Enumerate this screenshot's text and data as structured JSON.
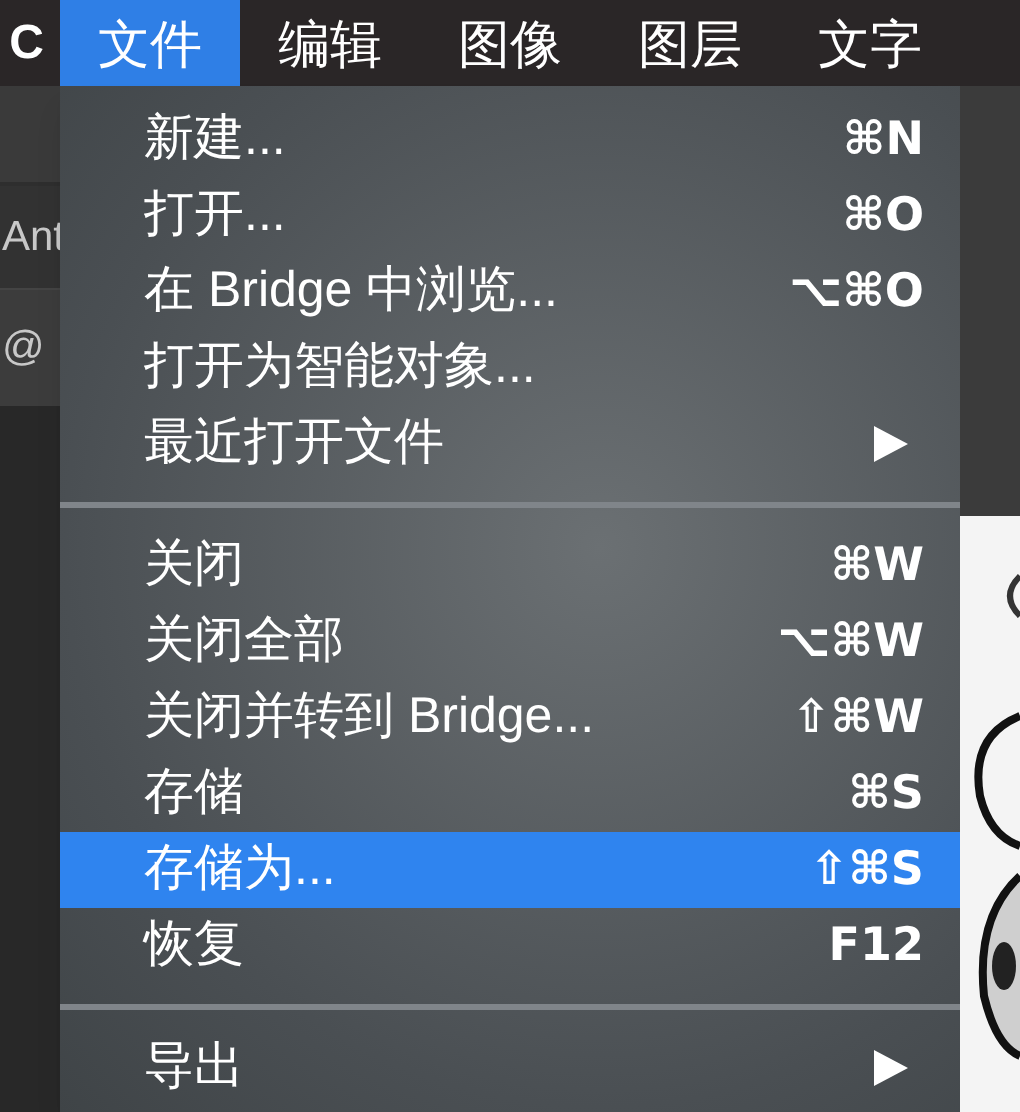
{
  "menu_bar": {
    "cut_text": "C",
    "items": [
      {
        "label": "文件",
        "selected": true
      },
      {
        "label": "编辑",
        "selected": false
      },
      {
        "label": "图像",
        "selected": false
      },
      {
        "label": "图层",
        "selected": false
      },
      {
        "label": "文字",
        "selected": false
      }
    ]
  },
  "background": {
    "font_field": "Ant",
    "document_tab": "@"
  },
  "file_menu": [
    {
      "kind": "item",
      "label": "新建...",
      "shortcut": "⌘N",
      "selected": false
    },
    {
      "kind": "item",
      "label": "打开...",
      "shortcut": "⌘O",
      "selected": false
    },
    {
      "kind": "item",
      "label": "在 Bridge 中浏览...",
      "shortcut": "⌥⌘O",
      "selected": false
    },
    {
      "kind": "item",
      "label": "打开为智能对象...",
      "selected": false
    },
    {
      "kind": "item",
      "label": "最近打开文件",
      "submenu": true,
      "selected": false
    },
    {
      "kind": "separator"
    },
    {
      "kind": "item",
      "label": "关闭",
      "shortcut": "⌘W",
      "selected": false
    },
    {
      "kind": "item",
      "label": "关闭全部",
      "shortcut": "⌥⌘W",
      "selected": false
    },
    {
      "kind": "item",
      "label": "关闭并转到 Bridge...",
      "shortcut": "⇧⌘W",
      "selected": false
    },
    {
      "kind": "item",
      "label": "存储",
      "shortcut": "⌘S",
      "selected": false
    },
    {
      "kind": "item",
      "label": "存储为...",
      "shortcut": "⇧⌘S",
      "selected": true
    },
    {
      "kind": "item",
      "label": "恢复",
      "shortcut": "F12",
      "selected": false
    },
    {
      "kind": "separator"
    },
    {
      "kind": "item",
      "label": "导出",
      "submenu": true,
      "selected": false
    }
  ]
}
